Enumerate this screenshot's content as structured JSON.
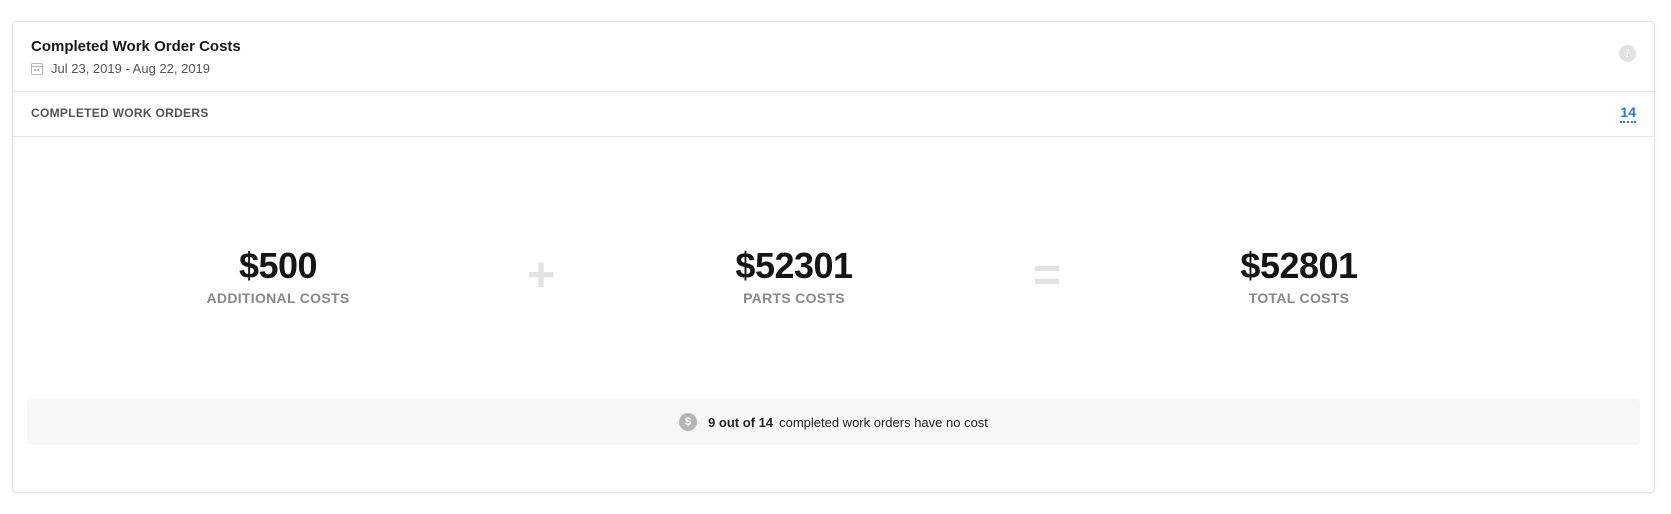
{
  "card": {
    "title": "Completed Work Order Costs",
    "date_range": "Jul 23, 2019 - Aug 22, 2019",
    "info_icon": "info-icon",
    "calendar_icon": "calendar-icon"
  },
  "subheader": {
    "label": "COMPLETED WORK ORDERS",
    "count": "14"
  },
  "metrics": {
    "additional": {
      "value": "$500",
      "label": "ADDITIONAL COSTS"
    },
    "parts": {
      "value": "$52301",
      "label": "PARTS COSTS"
    },
    "total": {
      "value": "$52801",
      "label": "TOTAL COSTS"
    },
    "plus_symbol": "+",
    "equals_symbol": "="
  },
  "footer": {
    "icon_glyph": "$",
    "strong_text": "9 out of 14",
    "text": "completed work orders have no cost"
  },
  "colors": {
    "accent_link": "#1e7be0",
    "muted_label": "#888888",
    "operator": "#e2e2e2"
  }
}
